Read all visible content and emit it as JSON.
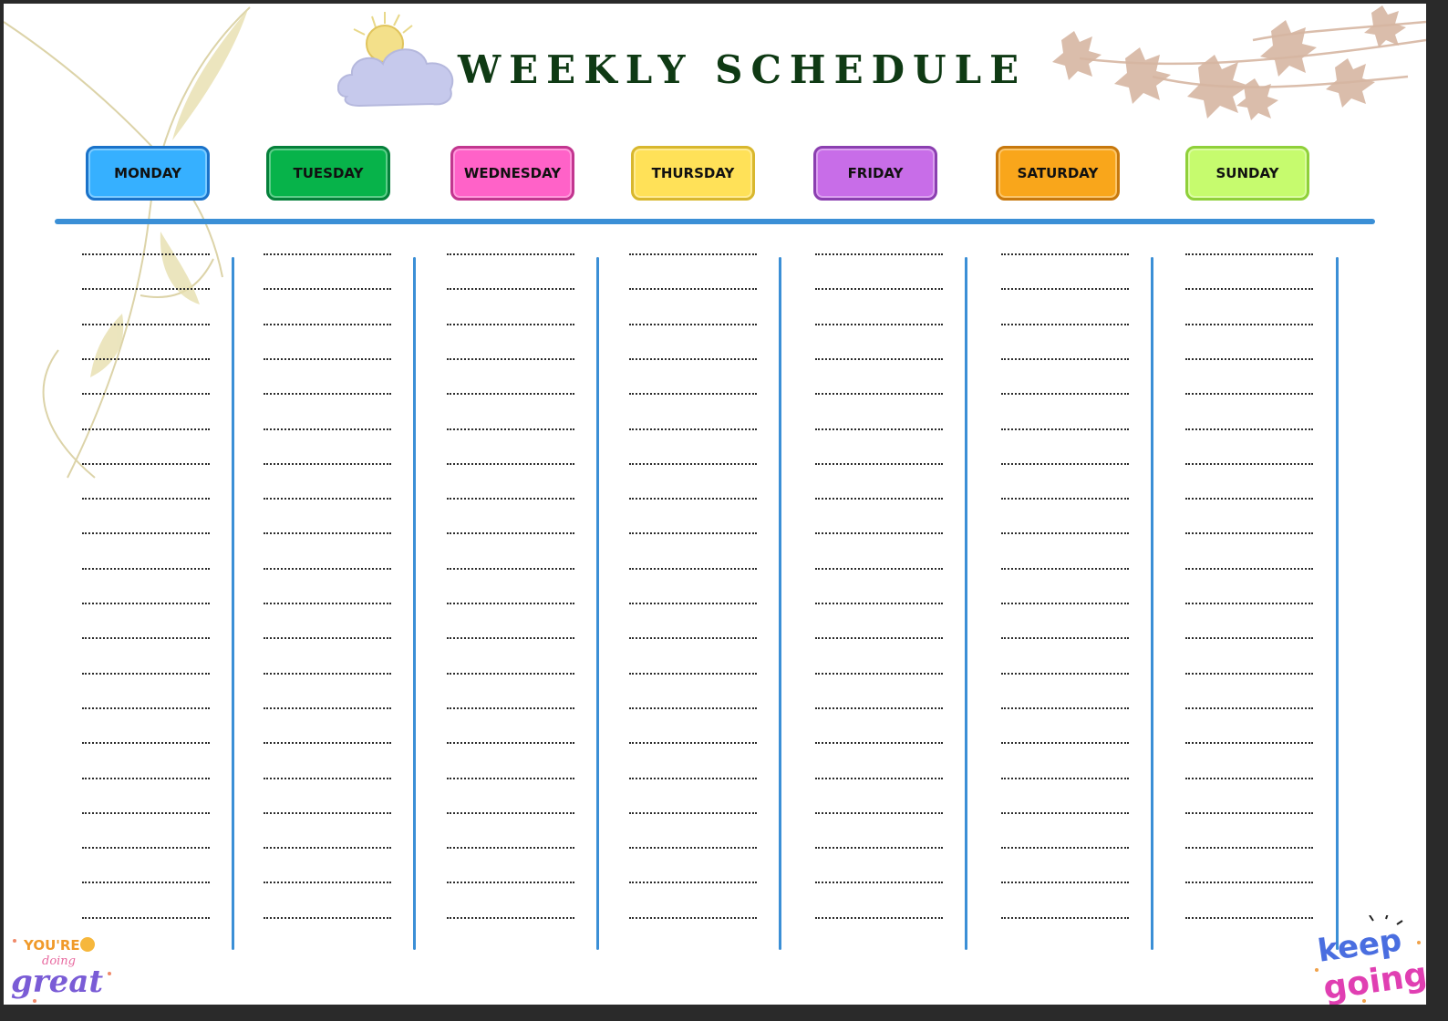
{
  "title": "WEEKLY SCHEDULE",
  "days": [
    {
      "label": "MONDAY",
      "color": "#36b0ff",
      "border": "#1a72c9"
    },
    {
      "label": "TUESDAY",
      "color": "#07b34a",
      "border": "#05803a"
    },
    {
      "label": "WEDNESDAY",
      "color": "#ff62c8",
      "border": "#c2368f"
    },
    {
      "label": "THURSDAY",
      "color": "#ffe158",
      "border": "#d8b72e"
    },
    {
      "label": "FRIDAY",
      "color": "#c86de8",
      "border": "#8b3fb0"
    },
    {
      "label": "SATURDAY",
      "color": "#f9a61b",
      "border": "#c7780d"
    },
    {
      "label": "SUNDAY",
      "color": "#c6fb6e",
      "border": "#8fd03a"
    }
  ],
  "accent_color": "#3b8fd6",
  "title_color": "#0f3a14",
  "lines_per_day": 20,
  "stickers": {
    "left": {
      "line1": "YOU'RE",
      "line2": "doing",
      "line3": "great"
    },
    "right": {
      "line1": "keep",
      "line2": "going"
    }
  }
}
